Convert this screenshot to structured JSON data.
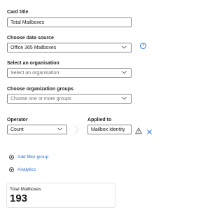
{
  "card_title": {
    "label": "Card title",
    "value": "Total Mailboxes"
  },
  "data_source": {
    "label": "Choose data source",
    "value": "Office 365 Mailboxes"
  },
  "organisation": {
    "label": "Select an organisation",
    "placeholder": "Select an organisation"
  },
  "org_groups": {
    "label": "Choose organization groups",
    "placeholder": "Choose one or more groups"
  },
  "operator": {
    "label": "Operator",
    "value": "Count"
  },
  "applied_to": {
    "label": "Applied to",
    "value": "Mailbox Identity"
  },
  "actions": {
    "add_filter": "Add filter group",
    "analytics": "Analytics"
  },
  "preview": {
    "title": "Total Mailboxes",
    "value": "193"
  },
  "colors": {
    "accent": "#2a6fd6",
    "warning": "#555555",
    "remove": "#2a6fd6"
  },
  "icons": [
    "chevron-down-icon",
    "info-icon",
    "warning-icon",
    "close-icon",
    "add-circle-icon",
    "arrow-right-icon"
  ]
}
